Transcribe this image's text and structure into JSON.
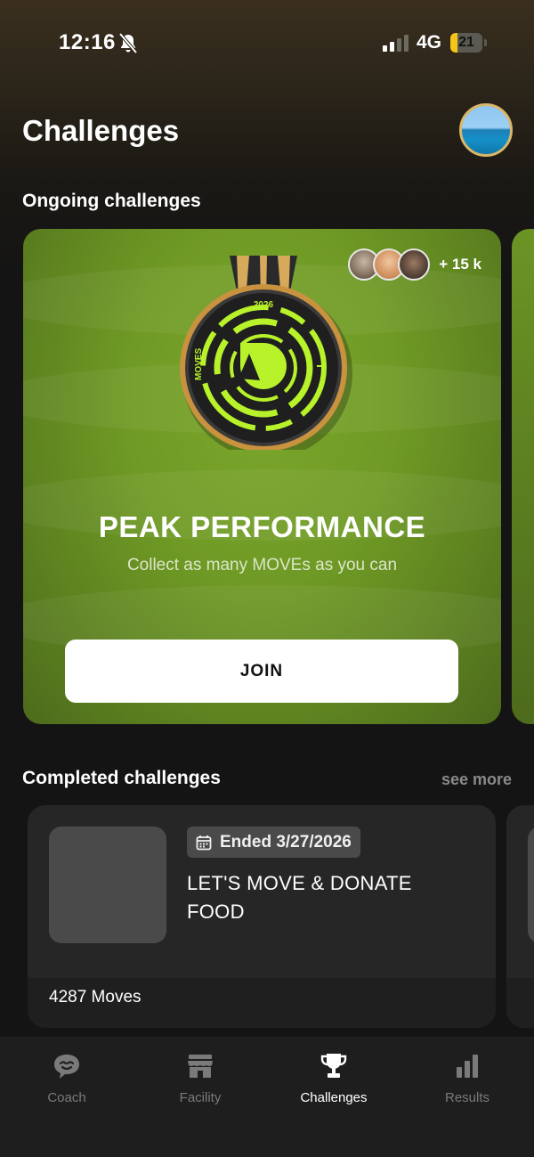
{
  "status_bar": {
    "time": "12:16",
    "network": "4G",
    "battery_level": "21",
    "battery_fraction": 0.21
  },
  "header": {
    "title": "Challenges"
  },
  "ongoing": {
    "section_title": "Ongoing challenges",
    "card": {
      "participants_more": "+ 15 k",
      "medal_year": "2026",
      "medal_brand": "MOVES",
      "title": "PEAK PERFORMANCE",
      "subtitle": "Collect as many MOVEs as you can",
      "join_label": "JOIN"
    }
  },
  "completed": {
    "section_title": "Completed challenges",
    "see_more_label": "see more",
    "card": {
      "ended_label": "Ended 3/27/2026",
      "title": "LET'S MOVE & DONATE FOOD",
      "moves": "4287 Moves"
    }
  },
  "tab_bar": {
    "tabs": [
      {
        "label": "Coach",
        "icon": "chat-bubble-icon",
        "active": false
      },
      {
        "label": "Facility",
        "icon": "storefront-icon",
        "active": false
      },
      {
        "label": "Challenges",
        "icon": "trophy-icon",
        "active": true
      },
      {
        "label": "Results",
        "icon": "bar-chart-icon",
        "active": false
      }
    ]
  },
  "colors": {
    "accent": "#b8f22a",
    "card_green": "#6f9a25",
    "background": "#141414"
  }
}
